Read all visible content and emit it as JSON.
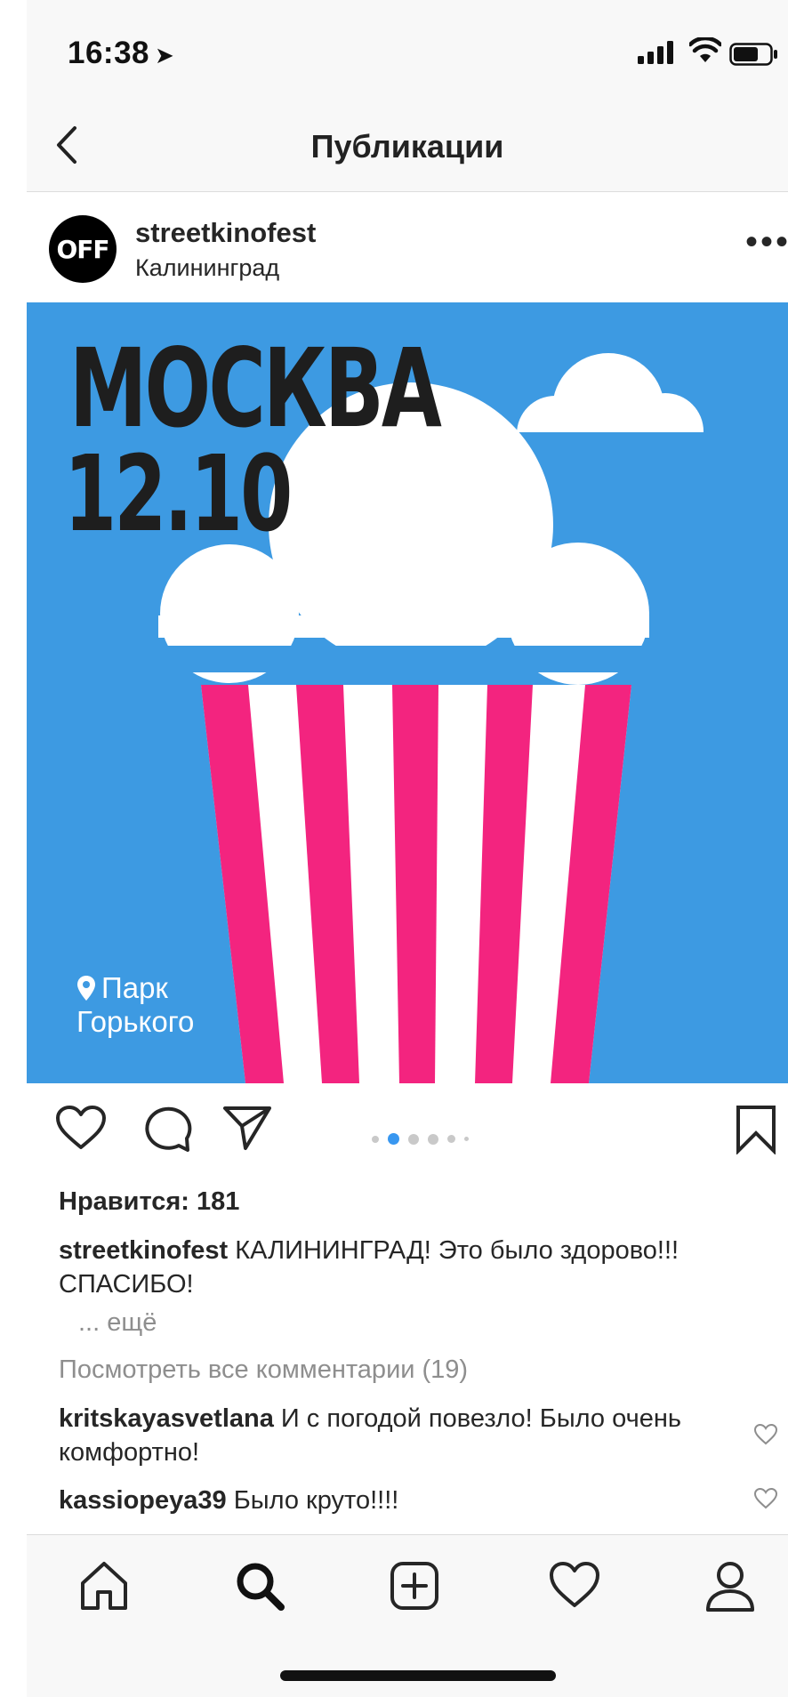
{
  "status_bar": {
    "time": "16:38",
    "location_arrow": "location-arrow-icon",
    "signal": "signal-icon",
    "wifi": "wifi-icon",
    "battery": "battery-icon"
  },
  "header": {
    "title": "Публикации",
    "back_icon": "chevron-left-icon"
  },
  "post": {
    "username": "streetkinofest",
    "location": "Калининград",
    "avatar_text": "OFF",
    "more_label": "•••",
    "image": {
      "city": "МОСКВА",
      "date": "12.10",
      "venue_line1": "Парк",
      "venue_line2": "Горького",
      "colors": {
        "sky": "#3d9ae2",
        "stripe": "#f3247f",
        "cloud": "#ffffff",
        "text": "#1e1e1e"
      }
    },
    "carousel": {
      "count": 6,
      "active_index": 1,
      "active_color": "#3897f0"
    },
    "likes_text": "Нравится: 181",
    "caption_user": "streetkinofest",
    "caption_text": "КАЛИНИНГРАД! Это было здорово!!! СПАСИБО!",
    "more_text": "... ещё",
    "view_comments": "Посмотреть все комментарии (19)",
    "comments": [
      {
        "user": "kritskayasvetlana",
        "text": "И с погодой повезло! Было очень комфортно!"
      },
      {
        "user": "kassiopeya39",
        "text": "Было круто!!!!"
      }
    ]
  },
  "tabbar": {
    "items": [
      "home-icon",
      "search-icon",
      "add-post-icon",
      "activity-heart-icon",
      "profile-icon"
    ]
  }
}
